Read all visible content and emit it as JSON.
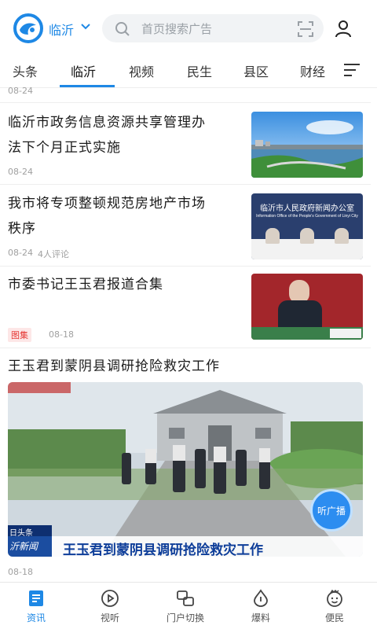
{
  "header": {
    "city": "临沂",
    "search_placeholder": "首页搜索广告"
  },
  "tabs": [
    "头条",
    "临沂",
    "视频",
    "民生",
    "县区",
    "财经"
  ],
  "active_tab": "临沂",
  "feed": {
    "top_date": "08-24",
    "items": [
      {
        "title_line1": "临沂市政务信息资源共享管理办",
        "title_line2": "法下个月正式实施",
        "date": "08-24"
      },
      {
        "title_line1": "我市将专项整顿规范房地产市场",
        "title_line2": "秩序",
        "date": "08-24",
        "comments": "4人评论",
        "thumb_text_cn": "临沂市人民政府新闻办公室",
        "thumb_text_en": "Information Office of the People's Government of Linyi City"
      },
      {
        "title_line1": "市委书记王玉君报道合集",
        "tag": "图集",
        "date": "08-18"
      },
      {
        "title_line1": "王玉君到蒙阴县调研抢险救灾工作",
        "date": "08-18",
        "video_caption": "王玉君到蒙阴县调研抢险救灾工作",
        "video_badge_top": "日头条",
        "video_badge_bottom": "沂新闻"
      }
    ]
  },
  "floating_button": "听广播",
  "bottom_nav": [
    {
      "label": "资讯",
      "icon": "news-icon"
    },
    {
      "label": "视听",
      "icon": "play-icon"
    },
    {
      "label": "门户切换",
      "icon": "switch-icon"
    },
    {
      "label": "爆料",
      "icon": "tip-off-icon"
    },
    {
      "label": "便民",
      "icon": "service-icon"
    }
  ],
  "colors": {
    "accent": "#1e88e5",
    "text": "#1a1a1a",
    "muted": "#a0a0a0",
    "tag": "#e53935"
  }
}
